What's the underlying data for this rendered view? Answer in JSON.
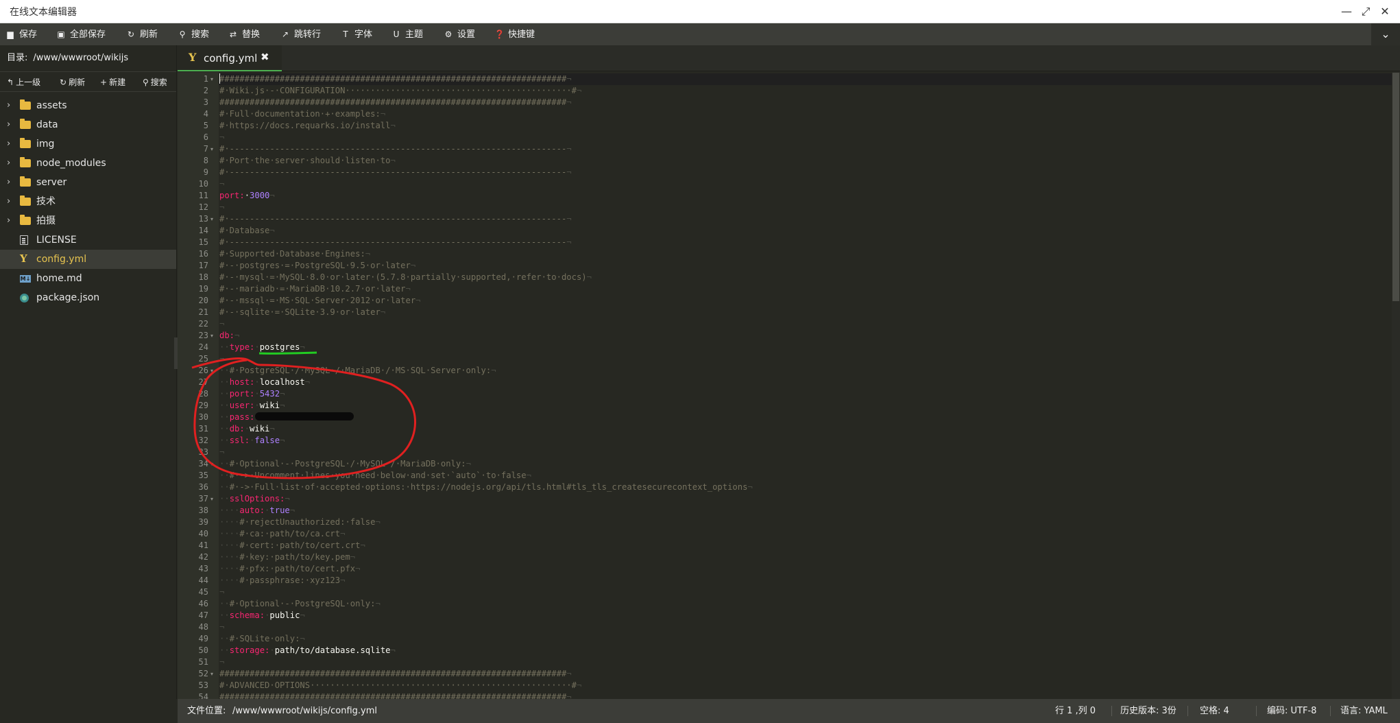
{
  "window": {
    "title": "在线文本编辑器"
  },
  "toolbar": {
    "items": [
      {
        "label": "保存",
        "icon": "save-icon"
      },
      {
        "label": "全部保存",
        "icon": "save-all-icon"
      },
      {
        "label": "刷新",
        "icon": "refresh-icon"
      },
      {
        "label": "搜索",
        "icon": "search-icon"
      },
      {
        "label": "替换",
        "icon": "replace-icon"
      },
      {
        "label": "跳转行",
        "icon": "goto-line-icon"
      },
      {
        "label": "字体",
        "icon": "font-icon"
      },
      {
        "label": "主题",
        "icon": "theme-icon"
      },
      {
        "label": "设置",
        "icon": "gear-icon"
      },
      {
        "label": "快捷键",
        "icon": "help-icon"
      }
    ]
  },
  "sidebar": {
    "dir_label": "目录:",
    "dir_path": "/www/wwwroot/wikijs",
    "tools": [
      {
        "label": "上一级",
        "icon": "up-arrow-icon"
      },
      {
        "label": "刷新",
        "icon": "refresh-icon"
      },
      {
        "label": "新建",
        "icon": "plus-icon"
      },
      {
        "label": "搜索",
        "icon": "search-icon"
      }
    ],
    "items": [
      {
        "name": "assets",
        "type": "folder"
      },
      {
        "name": "data",
        "type": "folder"
      },
      {
        "name": "img",
        "type": "folder"
      },
      {
        "name": "node_modules",
        "type": "folder"
      },
      {
        "name": "server",
        "type": "folder"
      },
      {
        "name": "技术",
        "type": "folder"
      },
      {
        "name": "拍摄",
        "type": "folder"
      },
      {
        "name": "LICENSE",
        "type": "doc"
      },
      {
        "name": "config.yml",
        "type": "yml",
        "active": true
      },
      {
        "name": "home.md",
        "type": "md"
      },
      {
        "name": "package.json",
        "type": "json"
      }
    ]
  },
  "tabs": [
    {
      "label": "config.yml",
      "close": "✖"
    }
  ],
  "editor": {
    "first_line": 1,
    "folds": [
      1,
      7,
      13,
      23,
      26,
      34,
      37,
      52
    ],
    "lines": [
      [
        [
          "c",
          "#####################################################################"
        ],
        [
          "e",
          "¬"
        ]
      ],
      [
        [
          "c",
          "#·Wiki.js·-·CONFIGURATION·············································#"
        ],
        [
          "e",
          "¬"
        ]
      ],
      [
        [
          "c",
          "#####################################################################"
        ],
        [
          "e",
          "¬"
        ]
      ],
      [
        [
          "c",
          "#·Full·documentation·+·examples:"
        ],
        [
          "e",
          "¬"
        ]
      ],
      [
        [
          "c",
          "#·https://docs.requarks.io/install"
        ],
        [
          "e",
          "¬"
        ]
      ],
      [
        [
          "e",
          "¬"
        ]
      ],
      [
        [
          "c",
          "#·-------------------------------------------------------------------"
        ],
        [
          "e",
          "¬"
        ]
      ],
      [
        [
          "c",
          "#·Port·the·server·should·listen·to"
        ],
        [
          "e",
          "¬"
        ]
      ],
      [
        [
          "c",
          "#·-------------------------------------------------------------------"
        ],
        [
          "e",
          "¬"
        ]
      ],
      [
        [
          "e",
          "¬"
        ]
      ],
      [
        [
          "k",
          "port:"
        ],
        [
          "s",
          "·"
        ],
        [
          "n",
          "3000"
        ],
        [
          "e",
          "¬"
        ]
      ],
      [
        [
          "e",
          "¬"
        ]
      ],
      [
        [
          "c",
          "#·-------------------------------------------------------------------"
        ],
        [
          "e",
          "¬"
        ]
      ],
      [
        [
          "c",
          "#·Database"
        ],
        [
          "e",
          "¬"
        ]
      ],
      [
        [
          "c",
          "#·-------------------------------------------------------------------"
        ],
        [
          "e",
          "¬"
        ]
      ],
      [
        [
          "c",
          "#·Supported·Database·Engines:"
        ],
        [
          "e",
          "¬"
        ]
      ],
      [
        [
          "c",
          "#·-·postgres·=·PostgreSQL·9.5·or·later"
        ],
        [
          "e",
          "¬"
        ]
      ],
      [
        [
          "c",
          "#·-·mysql·=·MySQL·8.0·or·later·(5.7.8·partially·supported,·refer·to·docs)"
        ],
        [
          "e",
          "¬"
        ]
      ],
      [
        [
          "c",
          "#·-·mariadb·=·MariaDB·10.2.7·or·later"
        ],
        [
          "e",
          "¬"
        ]
      ],
      [
        [
          "c",
          "#·-·mssql·=·MS·SQL·Server·2012·or·later"
        ],
        [
          "e",
          "¬"
        ]
      ],
      [
        [
          "c",
          "#·-·sqlite·=·SQLite·3.9·or·later"
        ],
        [
          "e",
          "¬"
        ]
      ],
      [
        [
          "e",
          "¬"
        ]
      ],
      [
        [
          "k",
          "db:"
        ],
        [
          "e",
          "¬"
        ]
      ],
      [
        [
          "e",
          "··"
        ],
        [
          "k",
          "type:"
        ],
        [
          "e",
          "·"
        ],
        [
          "s",
          "postgres"
        ],
        [
          "e",
          "¬"
        ]
      ],
      [
        [
          "e",
          "¬"
        ]
      ],
      [
        [
          "e",
          "··"
        ],
        [
          "c",
          "#·PostgreSQL·/·MySQL·/·MariaDB·/·MS·SQL·Server·only:"
        ],
        [
          "e",
          "¬"
        ]
      ],
      [
        [
          "e",
          "··"
        ],
        [
          "k",
          "host:"
        ],
        [
          "e",
          "·"
        ],
        [
          "s",
          "localhost"
        ],
        [
          "e",
          "¬"
        ]
      ],
      [
        [
          "e",
          "··"
        ],
        [
          "k",
          "port:"
        ],
        [
          "e",
          "·"
        ],
        [
          "n",
          "5432"
        ],
        [
          "e",
          "¬"
        ]
      ],
      [
        [
          "e",
          "··"
        ],
        [
          "k",
          "user:"
        ],
        [
          "e",
          "·"
        ],
        [
          "s",
          "wiki"
        ],
        [
          "e",
          "¬"
        ]
      ],
      [
        [
          "e",
          "··"
        ],
        [
          "k",
          "pass:"
        ],
        [
          "e",
          "¬"
        ]
      ],
      [
        [
          "e",
          "··"
        ],
        [
          "k",
          "db:"
        ],
        [
          "e",
          "·"
        ],
        [
          "s",
          "wiki"
        ],
        [
          "e",
          "¬"
        ]
      ],
      [
        [
          "e",
          "··"
        ],
        [
          "k",
          "ssl:"
        ],
        [
          "e",
          "·"
        ],
        [
          "n",
          "false"
        ],
        [
          "e",
          "¬"
        ]
      ],
      [
        [
          "e",
          "¬"
        ]
      ],
      [
        [
          "e",
          "··"
        ],
        [
          "c",
          "#·Optional·-·PostgreSQL·/·MySQL·/·MariaDB·only:"
        ],
        [
          "e",
          "¬"
        ]
      ],
      [
        [
          "e",
          "··"
        ],
        [
          "c",
          "#·->·Uncomment·lines·you·need·below·and·set·`auto`·to·false"
        ],
        [
          "e",
          "¬"
        ]
      ],
      [
        [
          "e",
          "··"
        ],
        [
          "c",
          "#·->·Full·list·of·accepted·options:·https://nodejs.org/api/tls.html#tls_tls_createsecurecontext_options"
        ],
        [
          "e",
          "¬"
        ]
      ],
      [
        [
          "e",
          "··"
        ],
        [
          "k",
          "sslOptions:"
        ],
        [
          "e",
          "¬"
        ]
      ],
      [
        [
          "e",
          "····"
        ],
        [
          "k",
          "auto:"
        ],
        [
          "e",
          "·"
        ],
        [
          "n",
          "true"
        ],
        [
          "e",
          "¬"
        ]
      ],
      [
        [
          "e",
          "····"
        ],
        [
          "c",
          "#·rejectUnauthorized:·false"
        ],
        [
          "e",
          "¬"
        ]
      ],
      [
        [
          "e",
          "····"
        ],
        [
          "c",
          "#·ca:·path/to/ca.crt"
        ],
        [
          "e",
          "¬"
        ]
      ],
      [
        [
          "e",
          "····"
        ],
        [
          "c",
          "#·cert:·path/to/cert.crt"
        ],
        [
          "e",
          "¬"
        ]
      ],
      [
        [
          "e",
          "····"
        ],
        [
          "c",
          "#·key:·path/to/key.pem"
        ],
        [
          "e",
          "¬"
        ]
      ],
      [
        [
          "e",
          "····"
        ],
        [
          "c",
          "#·pfx:·path/to/cert.pfx"
        ],
        [
          "e",
          "¬"
        ]
      ],
      [
        [
          "e",
          "····"
        ],
        [
          "c",
          "#·passphrase:·xyz123"
        ],
        [
          "e",
          "¬"
        ]
      ],
      [
        [
          "e",
          "¬"
        ]
      ],
      [
        [
          "e",
          "··"
        ],
        [
          "c",
          "#·Optional·-·PostgreSQL·only:"
        ],
        [
          "e",
          "¬"
        ]
      ],
      [
        [
          "e",
          "··"
        ],
        [
          "k",
          "schema:"
        ],
        [
          "e",
          "·"
        ],
        [
          "s",
          "public"
        ],
        [
          "e",
          "¬"
        ]
      ],
      [
        [
          "e",
          "¬"
        ]
      ],
      [
        [
          "e",
          "··"
        ],
        [
          "c",
          "#·SQLite·only:"
        ],
        [
          "e",
          "¬"
        ]
      ],
      [
        [
          "e",
          "··"
        ],
        [
          "k",
          "storage:"
        ],
        [
          "e",
          "·"
        ],
        [
          "s",
          "path/to/database.sqlite"
        ],
        [
          "e",
          "¬"
        ]
      ],
      [
        [
          "e",
          "¬"
        ]
      ],
      [
        [
          "c",
          "#####################################################################"
        ],
        [
          "e",
          "¬"
        ]
      ],
      [
        [
          "c",
          "#·ADVANCED·OPTIONS····················································#"
        ],
        [
          "e",
          "¬"
        ]
      ],
      [
        [
          "c",
          "#####################################################################"
        ],
        [
          "e",
          "¬"
        ]
      ]
    ]
  },
  "status": {
    "file_label": "文件位置:",
    "file_path": "/www/wwwroot/wikijs/config.yml",
    "position": "行 1 ,列 0",
    "history": "历史版本: 3份",
    "indent": "空格: 4",
    "encoding": "编码: UTF-8",
    "language": "语言: YAML"
  },
  "colors": {
    "comment": "#75715e",
    "key": "#f92672",
    "number": "#ae81ff",
    "string": "#f8f8f2",
    "annotation_red": "#e02020",
    "annotation_green": "#22cc22",
    "accent_yellow": "#e6c34f"
  }
}
